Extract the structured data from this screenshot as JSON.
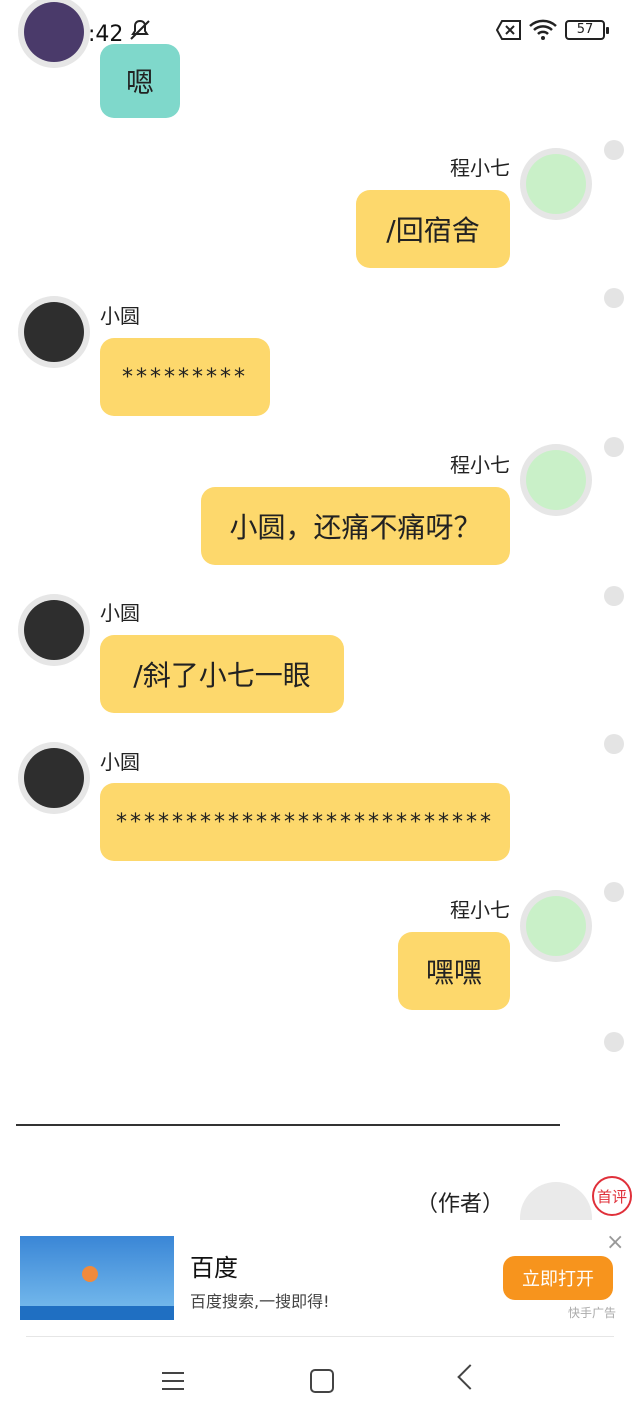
{
  "status_bar": {
    "time": "晚上9:42",
    "battery": "57"
  },
  "chat": {
    "messages": [
      {
        "sender": "",
        "text": "嗯",
        "side": "left"
      },
      {
        "sender": "程小七",
        "text": "/回宿舍",
        "side": "right"
      },
      {
        "sender": "小圆",
        "text": "*********",
        "side": "left"
      },
      {
        "sender": "程小七",
        "text": "小圆，还痛不痛呀？",
        "side": "right"
      },
      {
        "sender": "小圆",
        "text": "/斜了小七一眼",
        "side": "left"
      },
      {
        "sender": "小圆",
        "text": "***************************",
        "side": "left"
      },
      {
        "sender": "程小七",
        "text": "嘿嘿",
        "side": "right"
      }
    ]
  },
  "author_label": "（作者）",
  "first_review_badge": "首评",
  "ad": {
    "title": "百度",
    "description": "百度搜索,一搜即得!",
    "button": "立即打开",
    "label": "快手广告",
    "close": "×"
  },
  "colors": {
    "bubble": "#fdd86c",
    "bubble_teal": "#7fd8cb",
    "ad_button": "#f7941d",
    "badge": "#e0303a"
  }
}
